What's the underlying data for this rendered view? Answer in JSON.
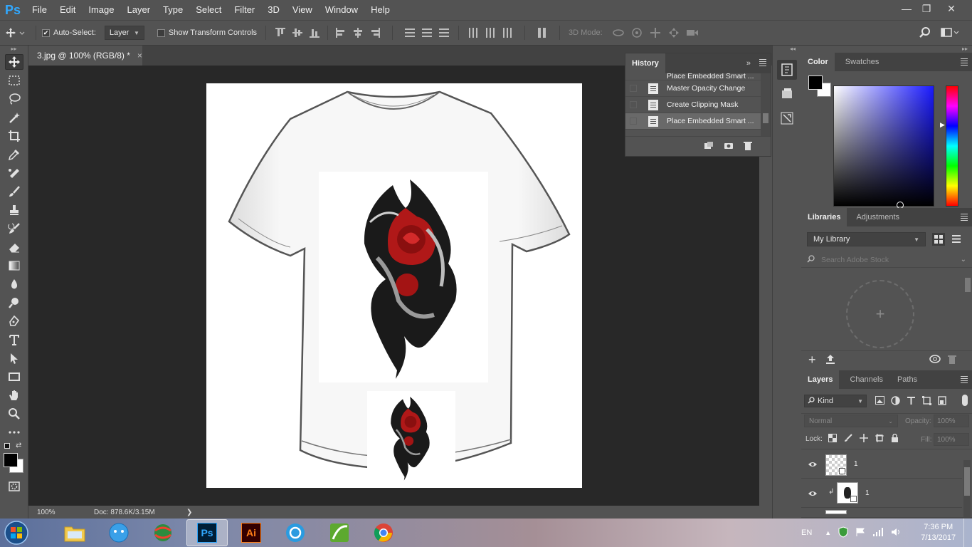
{
  "app": {
    "logo": "Ps",
    "menu": [
      "File",
      "Edit",
      "Image",
      "Layer",
      "Type",
      "Select",
      "Filter",
      "3D",
      "View",
      "Window",
      "Help"
    ]
  },
  "window_controls": {
    "minimize": "—",
    "restore": "❐",
    "close": "✕"
  },
  "options": {
    "auto_select_label": "Auto-Select:",
    "auto_select_value": "Layer",
    "show_transform_label": "Show Transform Controls",
    "mode_3d_label": "3D Mode:"
  },
  "document": {
    "tab_title": "3.jpg @ 100% (RGB/8) *",
    "close": "×"
  },
  "status": {
    "zoom": "100%",
    "doc_info": "Doc: 878.6K/3.15M",
    "arrow": "❯"
  },
  "history": {
    "tab_label": "History",
    "items": [
      {
        "label": "Place Embedded Smart ..."
      },
      {
        "label": "Master Opacity Change"
      },
      {
        "label": "Create Clipping Mask"
      },
      {
        "label": "Place Embedded Smart ..."
      }
    ]
  },
  "color_panel": {
    "tabs": [
      "Color",
      "Swatches"
    ]
  },
  "libraries": {
    "tabs": [
      "Libraries",
      "Adjustments"
    ],
    "library_name": "My Library",
    "search_placeholder": "Search Adobe Stock"
  },
  "layers": {
    "tabs": [
      "Layers",
      "Channels",
      "Paths"
    ],
    "filter_label": "Kind",
    "blend_mode": "Normal",
    "opacity_label": "Opacity:",
    "opacity_value": "100%",
    "lock_label": "Lock:",
    "fill_label": "Fill:",
    "fill_value": "100%",
    "items": [
      {
        "name": "1"
      },
      {
        "name": "1"
      }
    ]
  },
  "taskbar": {
    "language": "EN",
    "time": "7:36 PM",
    "date": "7/13/2017",
    "apps": [
      "windows-explorer",
      "messenger",
      "globe",
      "photoshop",
      "illustrator",
      "sync",
      "coreldraw",
      "chrome"
    ],
    "ps_label": "Ps",
    "ai_label": "Ai"
  },
  "colors": {
    "accent_ps": "#31a8ff",
    "accent_ai": "#ff7f18",
    "ui_bg": "#535353",
    "canvas_bg": "#282828"
  }
}
